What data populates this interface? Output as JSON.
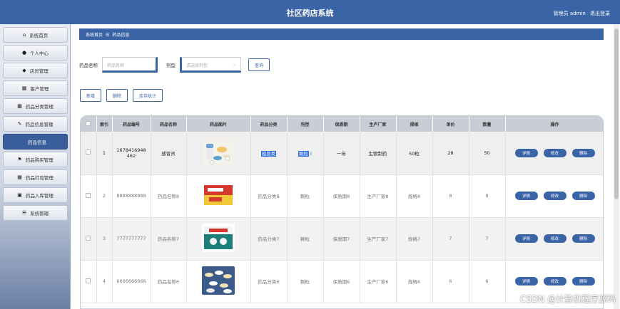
{
  "app": {
    "title": "社区药店系统",
    "user_label": "管理员 admin",
    "logout": "退出登录"
  },
  "sidebar": {
    "items": [
      {
        "icon": "⌂",
        "label": "系统首页"
      },
      {
        "icon": "●",
        "label": "个人中心"
      },
      {
        "icon": "◆",
        "label": "店员管理"
      },
      {
        "icon": "▦",
        "label": "客户管理"
      },
      {
        "icon": "▦",
        "label": "药品分类管理"
      },
      {
        "icon": "✎",
        "label": "药品信息管理"
      },
      {
        "icon": "",
        "label": "药品信息"
      },
      {
        "icon": "⚑",
        "label": "药品购买管理"
      },
      {
        "icon": "▦",
        "label": "药品打包管理"
      },
      {
        "icon": "▣",
        "label": "药品入库管理"
      },
      {
        "icon": "☰",
        "label": "系统管理"
      }
    ]
  },
  "breadcrumb": {
    "home": "系统首页",
    "sep": "☰",
    "current": "药品信息"
  },
  "search": {
    "name_label": "药品名称",
    "name_placeholder": "药品名称",
    "type_label": "剂型",
    "type_placeholder": "请选择剂型",
    "query_button": "查询"
  },
  "actions": {
    "add": "新增",
    "delete": "删除",
    "stock": "库存统计"
  },
  "table": {
    "headers": [
      "",
      "索引",
      "药品编号",
      "药品名称",
      "药品图片",
      "药品分类",
      "剂型",
      "保质期",
      "生产厂家",
      "规格",
      "单价",
      "数量",
      "操作"
    ],
    "rows": [
      {
        "index": "1",
        "code": "1678416948462",
        "name": "感冒灵",
        "category": "感冒类",
        "form": "颗粒",
        "shelf": "一年",
        "maker": "生物制药",
        "spec": "50粒",
        "price": "28",
        "qty": "50",
        "image": "pill-photo-1"
      },
      {
        "index": "2",
        "code": "8888888888",
        "name": "药品名称8",
        "category": "药品分类8",
        "form": "颗粒",
        "shelf": "保质期8",
        "maker": "生产厂家8",
        "spec": "规格8",
        "price": "8",
        "qty": "8",
        "image": "medicine-box-red"
      },
      {
        "index": "3",
        "code": "7777777777",
        "name": "药品名称7",
        "category": "药品分类7",
        "form": "颗粒",
        "shelf": "保质期7",
        "maker": "生产厂家7",
        "spec": "规格7",
        "price": "7",
        "qty": "7",
        "image": "medicine-box-green"
      },
      {
        "index": "4",
        "code": "6666666666",
        "name": "药品名称6",
        "category": "药品分类6",
        "form": "颗粒",
        "shelf": "保质期6",
        "maker": "生产厂家6",
        "spec": "规格6",
        "price": "6",
        "qty": "6",
        "image": "pill-photo-2"
      }
    ],
    "op_labels": {
      "detail": "详情",
      "edit": "修改",
      "delete": "删除"
    }
  },
  "watermark": "CSDN @计算机程序源码",
  "colors": {
    "primary": "#3b64a6",
    "highlight": "#2d6de0"
  }
}
